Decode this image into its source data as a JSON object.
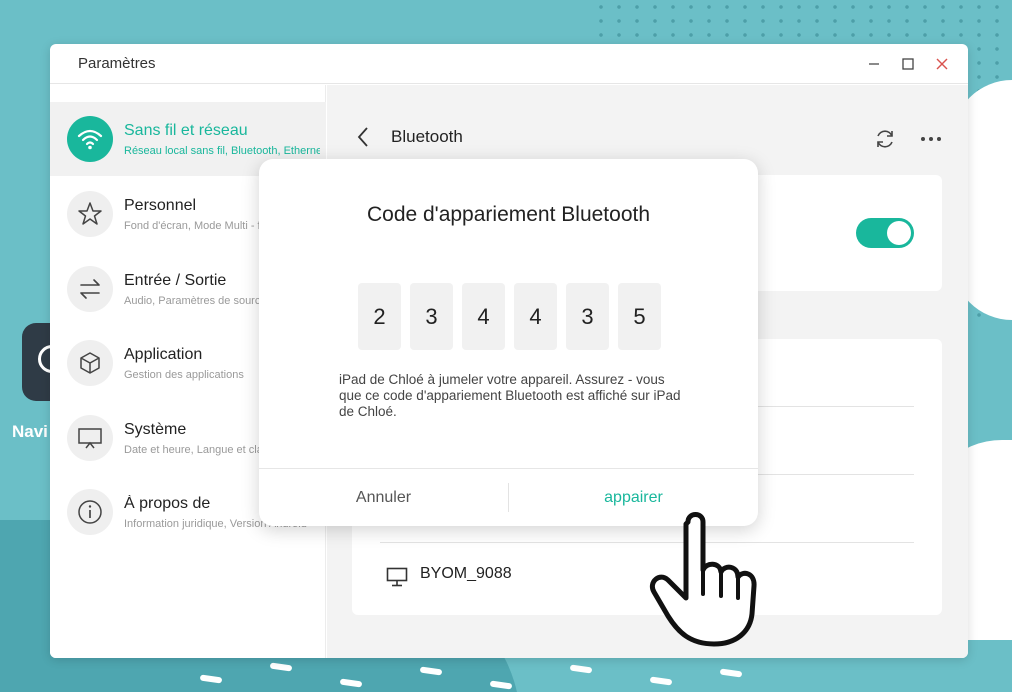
{
  "window": {
    "title": "Paramètres"
  },
  "sidebar": {
    "items": [
      {
        "title": "Sans fil et réseau",
        "subtitle": "Réseau local sans fil, Bluetooth, Ethernet",
        "icon": "wifi-icon",
        "active": true
      },
      {
        "title": "Personnel",
        "subtitle": "Fond d'écran, Mode Multi - fenêtre",
        "icon": "star-icon"
      },
      {
        "title": "Entrée / Sortie",
        "subtitle": "Audio, Paramètres de sources",
        "icon": "swap-arrows-icon"
      },
      {
        "title": "Application",
        "subtitle": "Gestion des applications",
        "icon": "cube-icon"
      },
      {
        "title": "Système",
        "subtitle": "Date et heure, Langue et clavier",
        "icon": "presentation-icon"
      },
      {
        "title": "À propos de",
        "subtitle": "Information juridique, Version Android",
        "icon": "info-icon"
      }
    ]
  },
  "content": {
    "header_title": "Bluetooth",
    "bluetooth_enabled": true,
    "devices": [
      {
        "name": "BYOM_9088",
        "icon": "monitor-icon"
      }
    ]
  },
  "dialog": {
    "title": "Code d'appariement Bluetooth",
    "digits": [
      "2",
      "3",
      "4",
      "4",
      "3",
      "5"
    ],
    "message": "iPad de Chloé à jumeler votre appareil. Assurez - vous que ce code d'appariement Bluetooth est affiché sur iPad de Chloé.",
    "cancel_label": "Annuler",
    "confirm_label": "appairer"
  },
  "desktop": {
    "icon_label": "Navi"
  },
  "colors": {
    "accent": "#19b79c",
    "background": "#6bbfc7"
  }
}
